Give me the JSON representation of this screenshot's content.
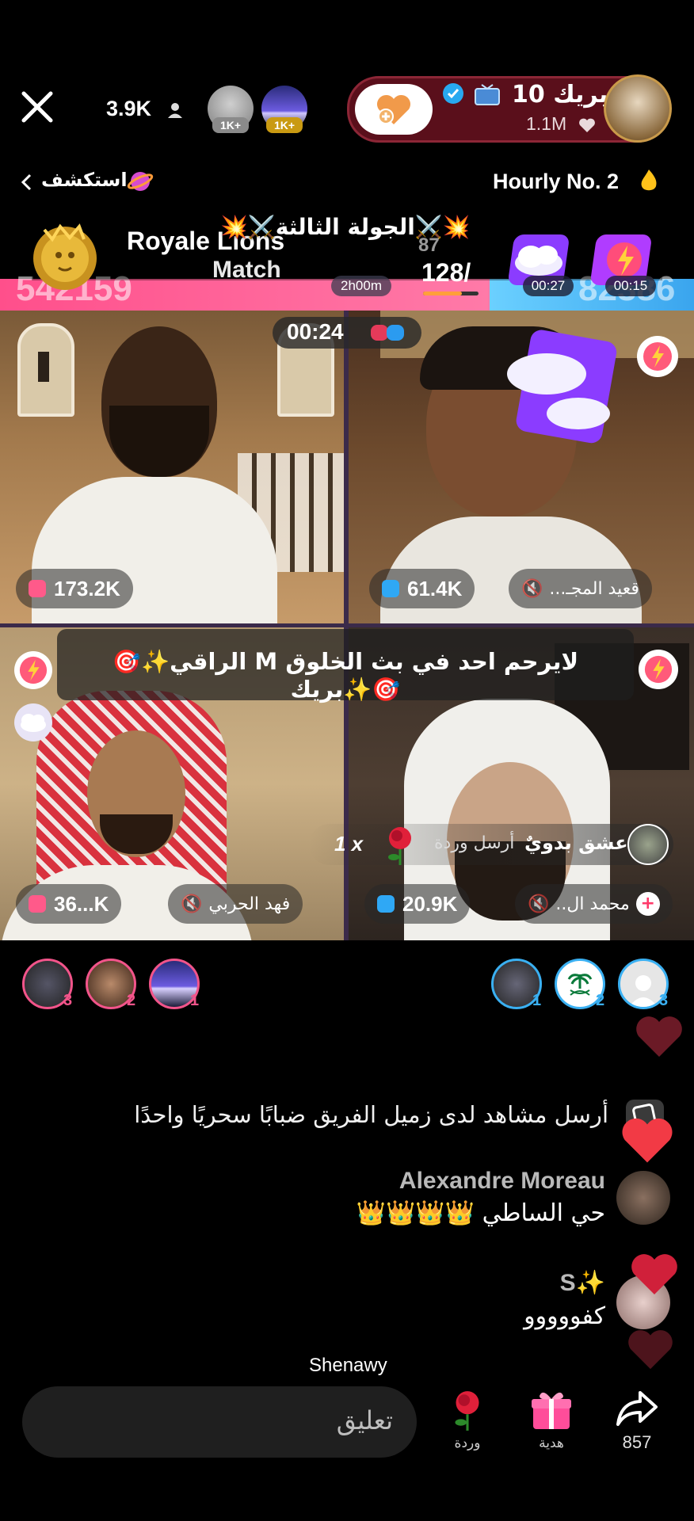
{
  "header": {
    "viewer_count": "3.9K",
    "top_gifters": [
      {
        "badge": "1K+"
      },
      {
        "badge": "1K+"
      }
    ],
    "host_name": "بريك 10",
    "host_likes": "1.1M",
    "explore_label": "استكشف",
    "hourly_rank": "Hourly No. 2"
  },
  "match": {
    "round_title": "💥⚔️الجولة الثالثة⚔️💥",
    "left_score": "542159",
    "right_score": "82386",
    "title_line1": "Royale Lions",
    "title_line2": "Match",
    "timer_label": "2h00m",
    "progress_value": "128/",
    "progress_top": "87",
    "timer1": "00:27",
    "timer2": "00:15",
    "countdown": "00:24"
  },
  "tiles": {
    "tl": {
      "score": "173.2K"
    },
    "tr": {
      "score": "61.4K",
      "name": "قعيد المجـ..."
    },
    "bl": {
      "score": "36...K",
      "name": "فهد الحربي"
    },
    "br": {
      "score": "20.9K",
      "name": "محمد ال.."
    }
  },
  "banner": {
    "text": "🎯✨الراقي M لايرحم احد في بث الخلوق بريك✨🎯"
  },
  "gift_notice": {
    "user": "عشق بدويٌ",
    "action": "أرسل وردة",
    "count": "1 x"
  },
  "ranks": {
    "left": [
      "3",
      "2",
      "1"
    ],
    "right": [
      "1",
      "2",
      "3"
    ]
  },
  "chat": {
    "system_msg": "أرسل مشاهد لدى زميل الفريق ضبابًا سحريًا واحدًا",
    "messages": [
      {
        "user": "Alexandre Moreau",
        "text": "حي الساطي 👑👑👑👑"
      },
      {
        "user": "S✨",
        "text": "كفووووو"
      }
    ]
  },
  "watermark": "Shenawy",
  "bottom_bar": {
    "comment_placeholder": "تعليق",
    "rose_label": "وردة",
    "gift_label": "هدية",
    "share_count": "857"
  },
  "colors": {
    "pink_bar": "#ff4f8b",
    "blue_bar": "#4fb8ff",
    "host_pill": "#6b1320",
    "like_heart": "#f05b6f"
  }
}
